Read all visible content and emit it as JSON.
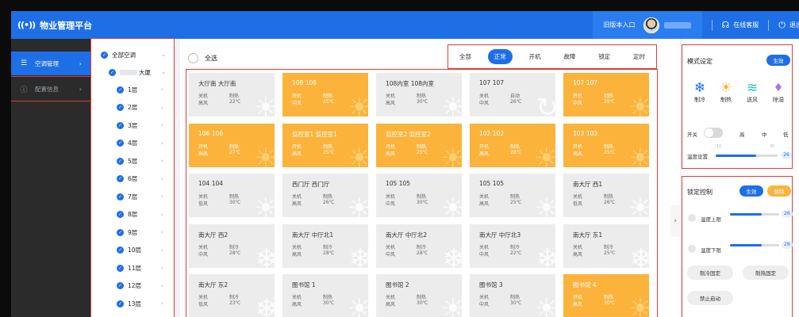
{
  "header": {
    "logo_glyph": "((•))",
    "title": "物业管理平台",
    "old_version": "旧版本入口",
    "online_service": "在线客服",
    "logout": "退出"
  },
  "leftnav": {
    "items": [
      {
        "label": "空调管理",
        "icon": "sliders-icon",
        "active": true
      },
      {
        "label": "配置信息",
        "icon": "info-icon",
        "active": false
      }
    ]
  },
  "tree": {
    "root": "全部空调",
    "building_suffix": "大厦",
    "floors": [
      "1层",
      "2层",
      "3层",
      "4层",
      "5层",
      "6层",
      "7层",
      "8层",
      "9层",
      "10层",
      "11层",
      "12层",
      "13层"
    ]
  },
  "main": {
    "select_all": "全选",
    "filters": [
      "全部",
      "正常",
      "开机",
      "故障",
      "锁定",
      "定时"
    ],
    "active_filter": "正常",
    "cards": [
      {
        "name": "大厅南   大厅南",
        "a": "关机",
        "b": "制热",
        "c": "高风",
        "d": "22℃",
        "hot": false,
        "sym": "sun"
      },
      {
        "name": "108   108",
        "a": "开机",
        "b": "制热",
        "c": "中风",
        "d": "25℃",
        "hot": true,
        "sym": "sun"
      },
      {
        "name": "108内室   108内室",
        "a": "关机",
        "b": "制热",
        "c": "高风",
        "d": "30℃",
        "hot": false,
        "sym": "sun"
      },
      {
        "name": "107   107",
        "a": "关机",
        "b": "自动",
        "c": "中风",
        "d": "26℃",
        "hot": false,
        "sym": "auto"
      },
      {
        "name": "107   107",
        "a": "开机",
        "b": "制热",
        "c": "中风",
        "d": "29℃",
        "hot": true,
        "sym": "sun"
      },
      {
        "name": "106   106",
        "a": "开机",
        "b": "制热",
        "c": "高风",
        "d": "27℃",
        "hot": true,
        "sym": "sun"
      },
      {
        "name": "监控室1   监控室1",
        "a": "开机",
        "b": "制热",
        "c": "高风",
        "d": "25℃",
        "hot": true,
        "sym": "sun"
      },
      {
        "name": "监控室2   监控室2",
        "a": "开机",
        "b": "制热",
        "c": "高风",
        "d": "25℃",
        "hot": true,
        "sym": "sun"
      },
      {
        "name": "102   102",
        "a": "开机",
        "b": "制热",
        "c": "高风",
        "d": "28℃",
        "hot": true,
        "sym": "sun"
      },
      {
        "name": "103   103",
        "a": "开机",
        "b": "制热",
        "c": "高风",
        "d": "25℃",
        "hot": true,
        "sym": "sun"
      },
      {
        "name": "104   104",
        "a": "关机",
        "b": "制热",
        "c": "低风",
        "d": "30℃",
        "hot": false,
        "sym": "sun"
      },
      {
        "name": "西门厅   西门厅",
        "a": "关机",
        "b": "制热",
        "c": "高风",
        "d": "26℃",
        "hot": false,
        "sym": "sun"
      },
      {
        "name": "105   105",
        "a": "关机",
        "b": "制热",
        "c": "中风",
        "d": "30℃",
        "hot": false,
        "sym": "sun"
      },
      {
        "name": "105   105",
        "a": "关机",
        "b": "制热",
        "c": "高风",
        "d": "25℃",
        "hot": false,
        "sym": "sun"
      },
      {
        "name": "南大厅   西1",
        "a": "关机",
        "b": "制热",
        "c": "低风",
        "d": "26℃",
        "hot": false,
        "sym": "sun"
      },
      {
        "name": "南大厅   西2",
        "a": "关机",
        "b": "制冷",
        "c": "中风",
        "d": "28℃",
        "hot": false,
        "sym": "snow"
      },
      {
        "name": "南大厅   中厅北1",
        "a": "关机",
        "b": "制冷",
        "c": "高风",
        "d": "28℃",
        "hot": false,
        "sym": "snow"
      },
      {
        "name": "南大厅   中厅北2",
        "a": "关机",
        "b": "制冷",
        "c": "中风",
        "d": "28℃",
        "hot": false,
        "sym": "snow"
      },
      {
        "name": "南大厅   中厅北3",
        "a": "关机",
        "b": "制冷",
        "c": "中风",
        "d": "22℃",
        "hot": false,
        "sym": "snow"
      },
      {
        "name": "南大厅   东1",
        "a": "关机",
        "b": "制冷",
        "c": "高风",
        "d": "25℃",
        "hot": false,
        "sym": "snow"
      },
      {
        "name": "南大厅   东2",
        "a": "关机",
        "b": "制冷",
        "c": "低风",
        "d": "23℃",
        "hot": false,
        "sym": "snow"
      },
      {
        "name": "图书馆   1",
        "a": "关机",
        "b": "制热",
        "c": "高风",
        "d": "30℃",
        "hot": false,
        "sym": "sun"
      },
      {
        "name": "图书馆   2",
        "a": "关机",
        "b": "制热",
        "c": "高风",
        "d": "30℃",
        "hot": false,
        "sym": "sun"
      },
      {
        "name": "图书馆   3",
        "a": "关机",
        "b": "制热",
        "c": "中风",
        "d": "30℃",
        "hot": false,
        "sym": "sun"
      },
      {
        "name": "图书馆   4",
        "a": "开机",
        "b": "制热",
        "c": "高风",
        "d": "30℃",
        "hot": true,
        "sym": "sun"
      }
    ]
  },
  "right": {
    "mode_title": "模式设定",
    "mode_btn": "生效",
    "modes": [
      {
        "label": "制冷",
        "icon": "snowflake-icon",
        "glyph": "❄",
        "color": "#1e6fe6"
      },
      {
        "label": "制热",
        "icon": "sun-icon",
        "glyph": "☀",
        "color": "#fbb33b"
      },
      {
        "label": "送风",
        "icon": "wind-icon",
        "glyph": "≋",
        "color": "#2bc2b5"
      },
      {
        "label": "除湿",
        "icon": "droplet-icon",
        "glyph": "💧",
        "color": "#a874e8"
      }
    ],
    "switch_label": "开关",
    "speeds": [
      "高",
      "中",
      "低"
    ],
    "temp_min": "16",
    "temp_max": "30",
    "temp_label": "温度设置",
    "temp_value": "26",
    "temp_level": 0.65,
    "lock_title": "锁定控制",
    "lock_apply": "生效",
    "lock_release": "解除",
    "upper_label": "温度上限",
    "upper_value": "26",
    "upper_level": 0.65,
    "lower_label": "温度下限",
    "lower_value": "26",
    "lower_level": 0.65,
    "btn_cool": "制冷固定",
    "btn_heat": "制热固定",
    "btn_nostart": "禁止启动"
  }
}
